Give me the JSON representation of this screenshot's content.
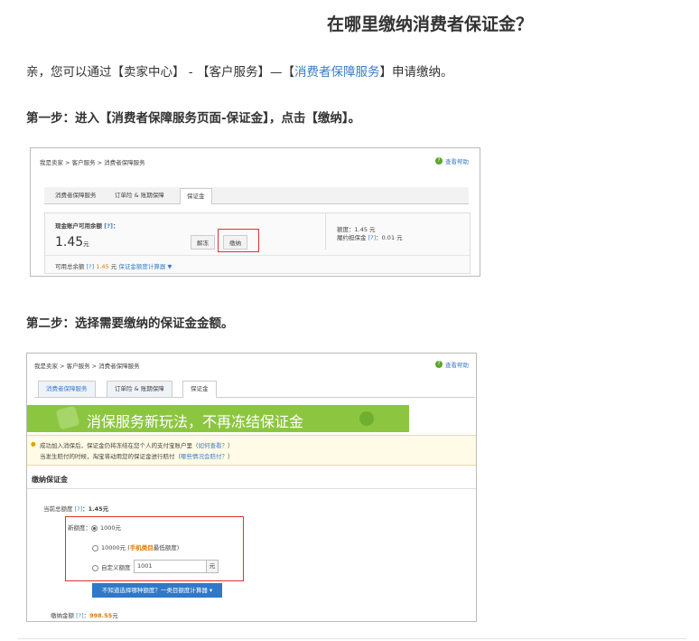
{
  "title": "在哪里缴纳消费者保证金？",
  "intro": {
    "prefix": "亲，您可以通过【卖家中心】 - 【客户服务】—【",
    "link": "消费者保障服务",
    "suffix": "】申请缴纳。"
  },
  "step1": "第一步：进入【消费者保障服务页面-保证金】，点击【缴纳】。",
  "step2": "第二步：选择需要缴纳的保证金金额。",
  "shot1": {
    "breadcrumb": "我是卖家 > 客户服务 > 消费者保障服务",
    "help": "查看帮助",
    "tabs": [
      "消费者保障服务",
      "订单险 & 账期保障",
      "保证金"
    ],
    "cash_label": "现金账户可用余额",
    "q": "[?]",
    "cash_value": "1.45",
    "yuan": "元",
    "unfreeze": "解冻",
    "pay": "缴纳",
    "quota": "额度：1.45 元",
    "occupied": "履约担保金",
    "occupied_value": "：0.01 元",
    "available_label": "可用总余额",
    "available_value": "1.45",
    "calc_link": "保证金额度计算器 ▼"
  },
  "shot2": {
    "breadcrumb": "我是卖家 > 客户服务 > 消费者保障服务",
    "help": "查看帮助",
    "tabs": [
      "消费者保障服务",
      "订单险 & 账期保障",
      "保证金"
    ],
    "banner": "消保服务新玩法，不再冻结保证金",
    "notice1": "成功加入消保后，保证金仍将冻结在您个人的支付宝账户里（",
    "notice1_link": "如何查看？",
    "notice1_end": "）",
    "notice2": "当发生赔付的时候，淘宝将动用您的保证金进行赔付（",
    "notice2_link": "哪些情况会赔付？",
    "notice2_end": "）",
    "section": "缴纳保证金",
    "current_label": "当前总额度",
    "q": "[?]",
    "current_value": "：1.45元",
    "new_label": "新额度：",
    "opt1": "1000元",
    "opt2_prefix": "10000元 (",
    "opt2_bold": "手机类目",
    "opt2_suffix": "最低额度)",
    "opt3": "自定义额度",
    "custom_value": "1001",
    "yuan": "元",
    "calc_btn": "不知道选择哪种额度？一类目额度计算器",
    "pay_label": "缴纳金额",
    "pay_value": "998.55",
    "pay_unit": "元"
  },
  "colors": {
    "accent": "#3a7dc9",
    "highlight": "#d33333",
    "banner": "#8cc641",
    "amount": "#e07800"
  }
}
